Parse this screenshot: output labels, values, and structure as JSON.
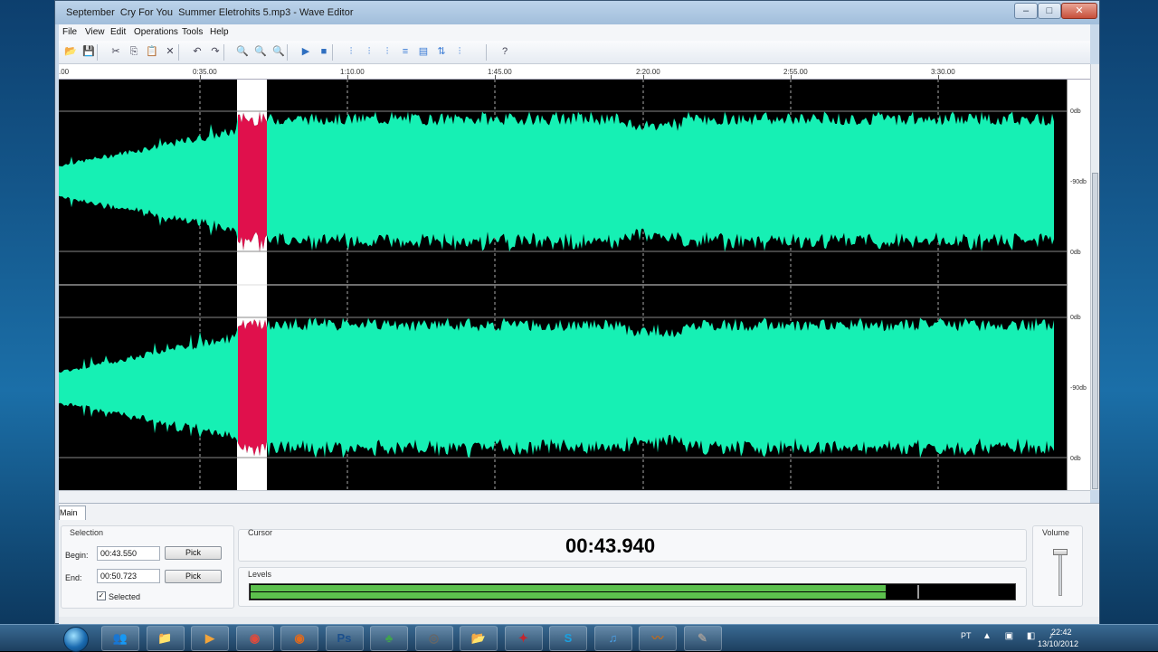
{
  "window": {
    "title": "September  Cry For You  Summer Eletrohits 5.mp3 - Wave Editor",
    "controls": {
      "minimize": "–",
      "maximize": "□",
      "close": "✕"
    }
  },
  "menu": [
    "File",
    "View",
    "Edit",
    "Operations",
    "Tools",
    "Help"
  ],
  "toolbar": {
    "icons": [
      "open-icon",
      "save-icon",
      "cut-icon",
      "copy-icon",
      "paste-icon",
      "delete-icon",
      "undo-icon",
      "redo-icon",
      "zoom-in-icon",
      "zoom-out-icon",
      "zoom-fit-icon",
      "play-icon",
      "stop-icon",
      "effect-1-icon",
      "effect-2-icon",
      "effect-3-icon",
      "effect-4-icon",
      "effect-5-icon",
      "effect-6-icon",
      "effect-7-icon",
      "help-icon"
    ],
    "glyphs": [
      "📂",
      "💾",
      "✂",
      "⎘",
      "📋",
      "✕",
      "↶",
      "↷",
      "🔍",
      "🔍",
      "🔍",
      "▶",
      "■",
      "⫶",
      "⫶",
      "⫶",
      "≡",
      "▤",
      "⇅",
      "⫶",
      "?"
    ]
  },
  "ruler": {
    "labels": [
      ".00",
      "0:35.00",
      "1:10.00",
      "1:45.00",
      "2:20.00",
      "2:55.00",
      "3:30.00"
    ]
  },
  "db_scale": {
    "labels": [
      "0db",
      "-90db",
      "0db",
      "0db",
      "-90db",
      "0db"
    ]
  },
  "colors": {
    "waveform": "#16f0b4",
    "selection_wave": "#e0104c",
    "selection_bg": "#ffffff",
    "background": "#000000"
  },
  "bottom": {
    "tab": "Main",
    "selection": {
      "title": "Selection",
      "begin_label": "Begin:",
      "begin_value": "00:43.550",
      "end_label": "End:",
      "end_value": "00:50.723",
      "pick_label": "Pick",
      "selected_label": "Selected",
      "selected_checked": true
    },
    "cursor": {
      "title": "Cursor",
      "time": "00:43.940"
    },
    "levels": {
      "title": "Levels",
      "level_top": 0.83,
      "level_bottom": 0.83
    },
    "volume": {
      "title": "Volume",
      "level": 0.85
    }
  },
  "taskbar": {
    "apps": [
      "explorer-users",
      "explorer-folder",
      "media-player",
      "chrome",
      "firefox",
      "photoshop",
      "app-green",
      "app-circle",
      "app-folder",
      "app-red",
      "skype",
      "itunes",
      "wave-editor",
      "app-stamp"
    ],
    "labels": [
      "👥",
      "📁",
      "▶",
      "◉",
      "◉",
      "Ps",
      "♣",
      "◎",
      "📂",
      "✦",
      "S",
      "♫",
      "〰",
      "✎"
    ],
    "tray_lang": "PT",
    "tray_icons": "▲ ▣ ◧ ♪",
    "time": "22:42",
    "date": "13/10/2012"
  }
}
